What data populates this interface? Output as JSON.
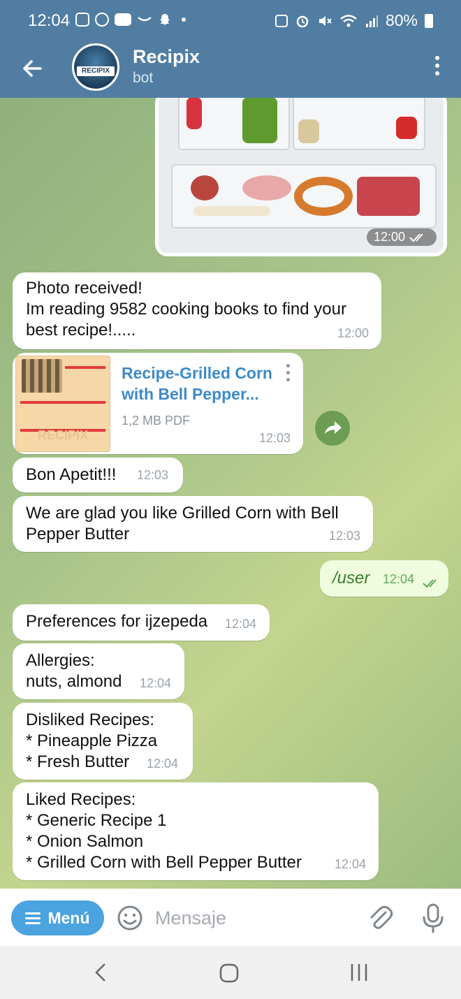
{
  "status_bar": {
    "time": "12:04",
    "battery": "80%",
    "left_icons": [
      "instagram-icon",
      "messenger-icon",
      "youtube-icon",
      "amazon-icon",
      "snapchat-icon",
      "dot-icon"
    ],
    "right_icons": [
      "battery-saver-icon",
      "alarm-icon",
      "mute-icon",
      "wifi-icon",
      "signal-icon",
      "battery-icon"
    ]
  },
  "header": {
    "title": "Recipix",
    "subtitle": "bot",
    "avatar_text": "RECIPIX",
    "color": "#517da2"
  },
  "messages": [
    {
      "type": "photo",
      "direction": "out",
      "time": "12:00",
      "status": "read"
    },
    {
      "type": "text",
      "direction": "in",
      "text": "Photo received!\nIm reading 9582 cooking books to find your\nbest recipe!.....",
      "time": "12:00"
    },
    {
      "type": "file",
      "direction": "in",
      "file_name": "Recipe-Grilled Corn\nwith Bell Pepper...",
      "file_size": "1,2 MB PDF",
      "thumb_text": "RECIPIX",
      "time": "12:03"
    },
    {
      "type": "text",
      "direction": "in",
      "text": "Bon Apetit!!!",
      "time": "12:03"
    },
    {
      "type": "text",
      "direction": "in",
      "text": "We are glad you like Grilled Corn with Bell\nPepper Butter",
      "time": "12:03"
    },
    {
      "type": "text",
      "direction": "out",
      "text": "/user",
      "time": "12:04",
      "status": "read"
    },
    {
      "type": "text",
      "direction": "in",
      "text": "Preferences for ijzepeda",
      "time": "12:04"
    },
    {
      "type": "text",
      "direction": "in",
      "text": "Allergies:\nnuts, almond",
      "time": "12:04"
    },
    {
      "type": "text",
      "direction": "in",
      "text": "Disliked Recipes:\n* Pineapple Pizza\n* Fresh Butter",
      "time": "12:04"
    },
    {
      "type": "text",
      "direction": "in",
      "text": "Liked Recipes:\n* Generic Recipe 1\n* Onion Salmon\n* Grilled Corn with Bell Pepper Butter",
      "time": "12:04"
    }
  ],
  "input_bar": {
    "menu_label": "Menú",
    "placeholder": "Mensaje",
    "accent": "#4ba3e0"
  },
  "nav_bar": {
    "icons": [
      "back-icon",
      "home-icon",
      "recents-icon"
    ]
  }
}
